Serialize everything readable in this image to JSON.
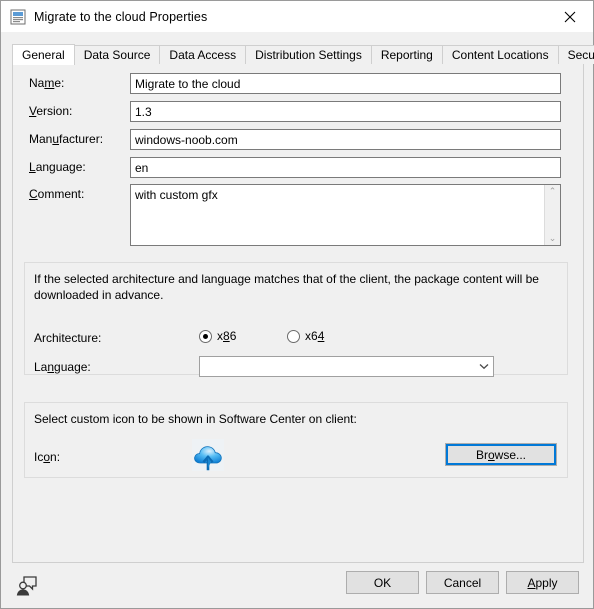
{
  "window": {
    "title": "Migrate to the cloud Properties",
    "title_icon": "package-properties-icon",
    "close_label": "✕"
  },
  "tabs": [
    {
      "label": "General",
      "active": true
    },
    {
      "label": "Data Source",
      "active": false
    },
    {
      "label": "Data Access",
      "active": false
    },
    {
      "label": "Distribution Settings",
      "active": false
    },
    {
      "label": "Reporting",
      "active": false
    },
    {
      "label": "Content Locations",
      "active": false
    },
    {
      "label": "Security",
      "active": false
    }
  ],
  "general": {
    "fields": [
      {
        "label_pre": "Na",
        "label_acc": "m",
        "label_post": "e:",
        "value": "Migrate to the cloud"
      },
      {
        "label_pre": "",
        "label_acc": "V",
        "label_post": "ersion:",
        "value": "1.3"
      },
      {
        "label_pre": "Man",
        "label_acc": "u",
        "label_post": "facturer:",
        "value": "windows-noob.com"
      },
      {
        "label_pre": "",
        "label_acc": "L",
        "label_post": "anguage:",
        "value": "en"
      }
    ],
    "comment": {
      "label_pre": "",
      "label_acc": "C",
      "label_post": "omment:",
      "value": "with custom gfx",
      "scroll_up": "⌃",
      "scroll_down": "⌄"
    },
    "architecture_group": {
      "description": "If the selected architecture and language matches that of the client, the package content will be downloaded in advance.",
      "arch_label": "Architecture:",
      "options": [
        {
          "label_pre": "x",
          "label_acc": "8",
          "label_post": "6",
          "checked": true
        },
        {
          "label_pre": "x6",
          "label_acc": "4",
          "label_post": "",
          "checked": false
        }
      ],
      "language_label_pre": "La",
      "language_label_acc": "n",
      "language_label_post": "guage:",
      "language_value": "",
      "dropdown_arrow": "⌄"
    },
    "icon_group": {
      "description": "Select custom icon to be shown in Software Center on client:",
      "icon_label_pre": "Ic",
      "icon_label_acc": "o",
      "icon_label_post": "n:",
      "icon_name": "cloud-upload-icon",
      "browse_pre": "Br",
      "browse_acc": "o",
      "browse_post": "wse..."
    }
  },
  "bottom": {
    "feedback_icon": "send-feedback-icon",
    "ok_label": "OK",
    "cancel_label": "Cancel",
    "apply_pre": "",
    "apply_acc": "A",
    "apply_post": "pply"
  },
  "colors": {
    "accent": "#0078d7",
    "dialog_bg": "#f0f0f0",
    "field_bg": "#ffffff",
    "border": "#7a7a7a",
    "cloud_blue": "#1c9ae8"
  }
}
